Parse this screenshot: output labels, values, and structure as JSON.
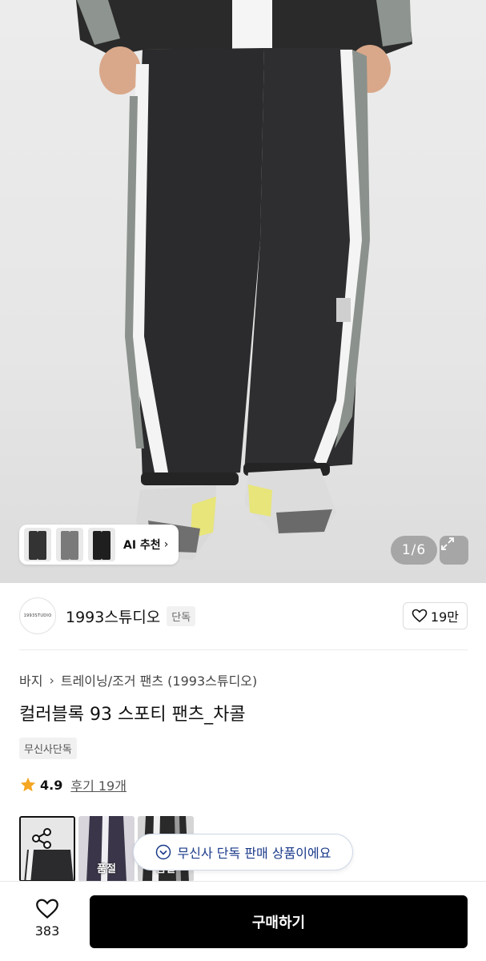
{
  "hero": {
    "image_counter": "1/6",
    "ai_recommend_label": "AI 추천",
    "chevron_glyph": "›"
  },
  "brand": {
    "logo_text": "1993STUDIO",
    "name": "1993스튜디오",
    "tag": "단독",
    "likes": "19만"
  },
  "product": {
    "breadcrumb": [
      "바지",
      "트레이닝/조거 팬츠 (1993스튜디오)"
    ],
    "breadcrumb_sep": "›",
    "title": "컬러블록 93 스포티 팬츠_차콜",
    "exclusive_badge": "무신사단독",
    "rating": "4.9",
    "review_link": "후기 19개"
  },
  "options": [
    {
      "label": ""
    },
    {
      "label": "품절"
    },
    {
      "label": "품절"
    }
  ],
  "toast": {
    "text": "무신사 단독 판매 상품이에요"
  },
  "bottom_bar": {
    "wish_count": "383",
    "buy_label": "구매하기"
  },
  "colors": {
    "buy_button": "#000000",
    "toast_text": "#1a3a8a",
    "star": "#f5a623"
  }
}
